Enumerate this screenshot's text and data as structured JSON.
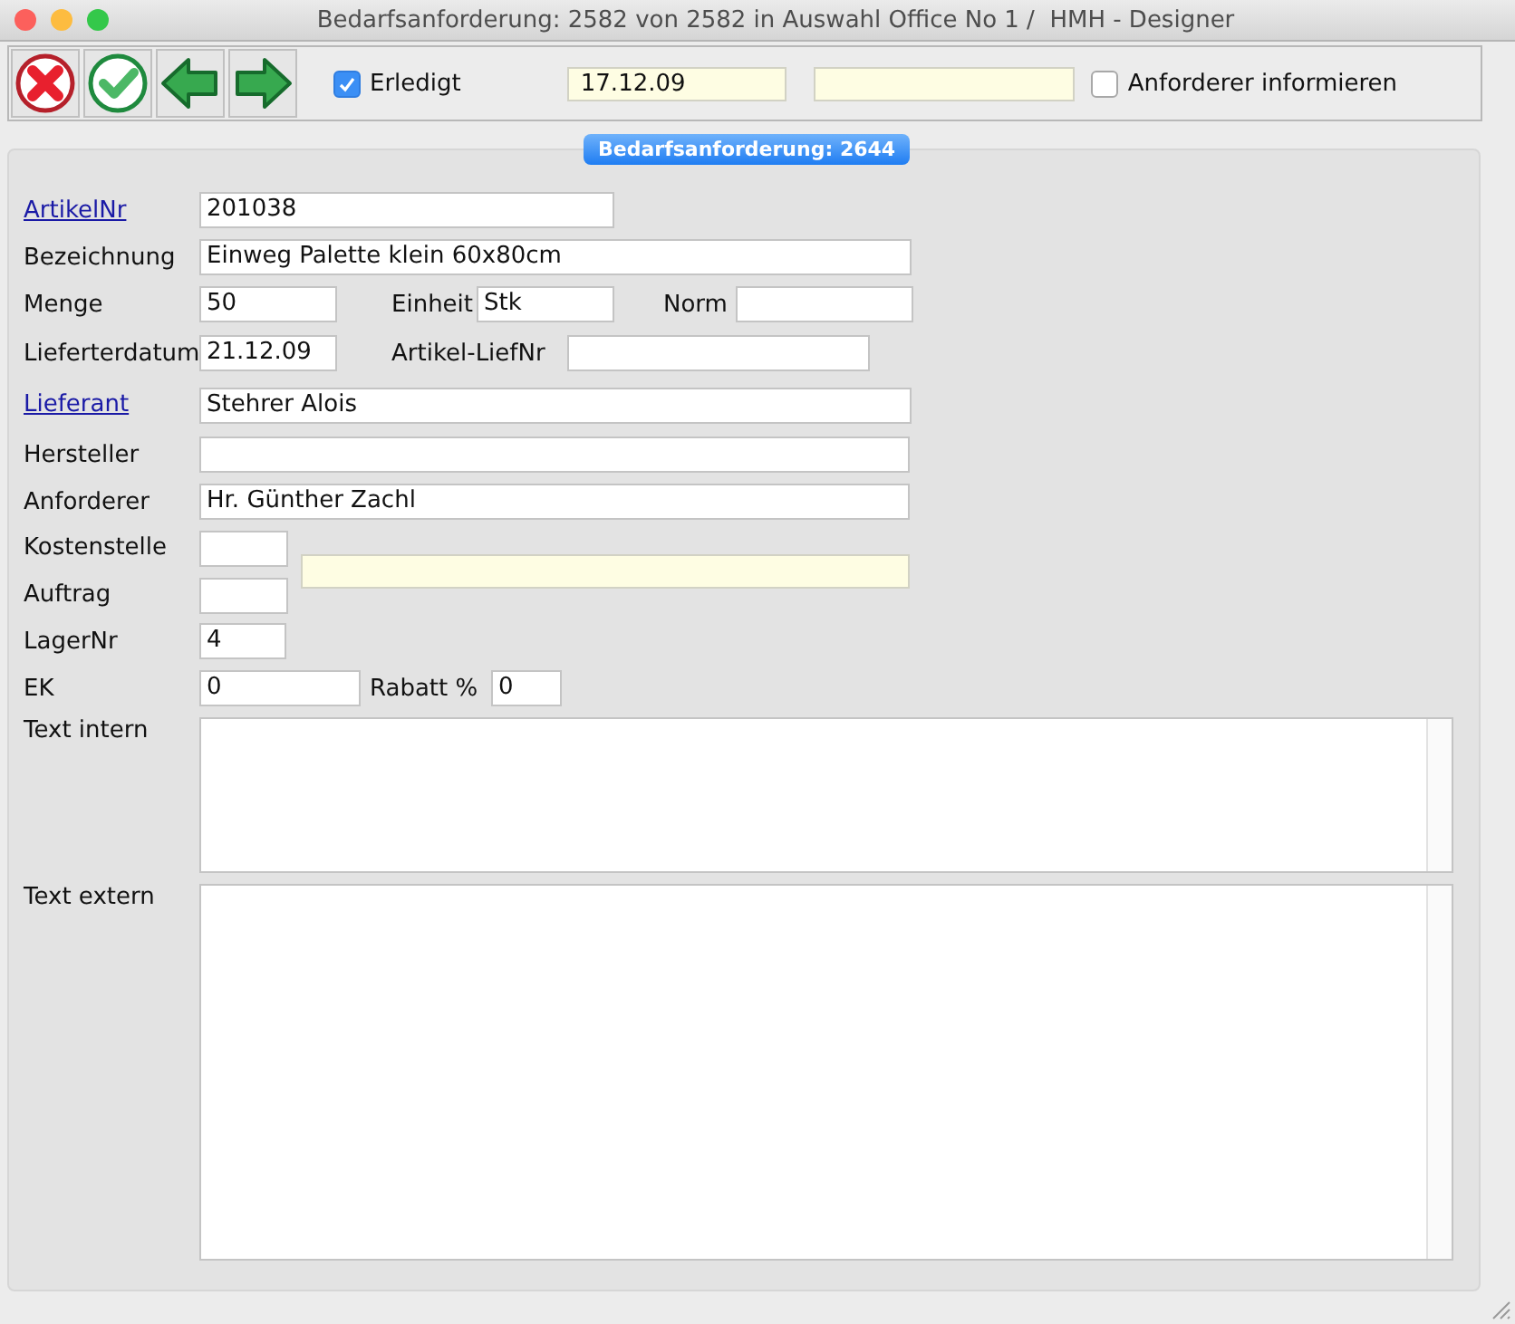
{
  "window": {
    "title": "Bedarfsanforderung: 2582 von 2582 in Auswahl Office No 1 /  HMH - Designer"
  },
  "toolbar": {
    "buttons": [
      {
        "kind": "cancel"
      },
      {
        "kind": "confirm"
      },
      {
        "kind": "back"
      },
      {
        "kind": "forward"
      }
    ],
    "done": {
      "label": "Erledigt",
      "checked": true
    },
    "date": "17.12.09",
    "notify": {
      "label": "Anforderer informieren",
      "checked": false
    }
  },
  "section_badge": "Bedarfsanforderung: 2644",
  "form": {
    "artikel_nr": {
      "label": "ArtikelNr",
      "link": true,
      "value": "201038"
    },
    "bezeichnung": {
      "label": "Bezeichnung",
      "link": false,
      "value": "Einweg Palette klein 60x80cm"
    },
    "menge": {
      "label": "Menge",
      "link": false,
      "value": "50"
    },
    "einheit": {
      "label": "Einheit",
      "link": false,
      "value": "Stk"
    },
    "norm": {
      "label": "Norm",
      "link": false
    },
    "lieferterdatum": {
      "label": "Lieferterdatum",
      "link": false,
      "value": "21.12.09"
    },
    "artikel_liefnr": {
      "label": "Artikel-LiefNr",
      "link": false
    },
    "lieferant": {
      "label": "Lieferant",
      "link": true,
      "value": "Stehrer Alois"
    },
    "hersteller": {
      "label": "Hersteller",
      "link": false
    },
    "anforderer": {
      "label": "Anforderer",
      "link": false,
      "value": "Hr. Günther Zachl"
    },
    "kostenstelle": {
      "label": "Kostenstelle",
      "link": false
    },
    "auftrag": {
      "label": "Auftrag",
      "link": false
    },
    "lager_nr": {
      "label": "LagerNr",
      "link": false,
      "value": "4"
    },
    "ek": {
      "label": "EK",
      "link": false,
      "value": "0"
    },
    "rabatt": {
      "label": "Rabatt %",
      "link": false,
      "value": "0"
    },
    "text_intern": {
      "label": "Text intern",
      "link": false
    },
    "text_extern": {
      "label": "Text extern",
      "link": false
    }
  }
}
